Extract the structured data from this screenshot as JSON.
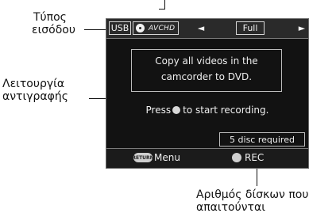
{
  "annotations": {
    "input_type_line1": "Τύπος",
    "input_type_line2": "εισόδου",
    "copy_mode_line1": "Λειτουργία",
    "copy_mode_line2": "αντιγραφής",
    "discs_needed_line1": "Αριθμός δίσκων που",
    "discs_needed_line2": "απαιτούνται"
  },
  "screen": {
    "input_type": "USB",
    "format_badge": "AVCHD",
    "left_arrow": "◄",
    "copy_mode": "Full",
    "right_arrow": "►",
    "message_line1": "Copy all videos in the",
    "message_line2": "camcorder to DVD.",
    "press_prefix": "Press",
    "press_suffix": "to start recording.",
    "disc_required": "5 disc required",
    "return_key": "RETURN",
    "menu_label": "Menu",
    "rec_label": "REC"
  }
}
